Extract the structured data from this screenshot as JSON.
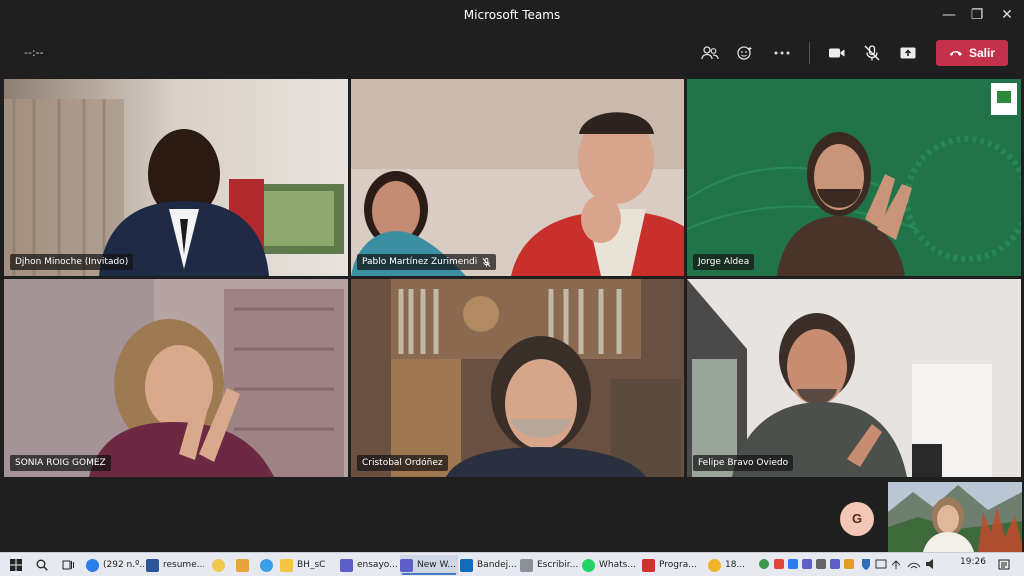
{
  "window": {
    "title": "Microsoft Teams",
    "minimize": "—",
    "maximize": "❐",
    "close": "✕"
  },
  "meeting": {
    "timer": "--:--",
    "leave_label": "Salir"
  },
  "participants": [
    {
      "name": "Djhon Minoche (Invitado)",
      "muted": false
    },
    {
      "name": "Pablo Martínez Zurimendi",
      "muted": true
    },
    {
      "name": "Jorge Aldea",
      "muted": false
    },
    {
      "name": "SONIA ROIG GOMEZ",
      "muted": false
    },
    {
      "name": "Cristobal Ordóñez",
      "muted": false
    },
    {
      "name": "Felipe Bravo Oviedo",
      "muted": false
    }
  ],
  "avatar": {
    "initial": "G"
  },
  "taskbar": {
    "items": [
      {
        "label": "(292 n.º...",
        "color": "#2b7de9"
      },
      {
        "label": "resume...",
        "color": "#2b579a"
      },
      {
        "label": "",
        "color": "#f2c94c"
      },
      {
        "label": "",
        "color": "#e8a33c"
      },
      {
        "label": "",
        "color": "#3aa0e8"
      },
      {
        "label": "BH_sC",
        "color": "#f4c542"
      },
      {
        "label": "ensayo...",
        "color": "#5b5fc7"
      },
      {
        "label": "New W...",
        "color": "#5b5fc7"
      },
      {
        "label": "Bandej...",
        "color": "#0f6cbd"
      },
      {
        "label": "Escribir...",
        "color": "#8a8f99"
      },
      {
        "label": "Whats...",
        "color": "#25d366"
      },
      {
        "label": "Progra...",
        "color": "#d32f2f"
      }
    ],
    "temp": "18...",
    "time": "19:26"
  },
  "colors": {
    "leave": "#c4314b",
    "background": "#1f1f1f",
    "accent": "#4a78c4"
  }
}
